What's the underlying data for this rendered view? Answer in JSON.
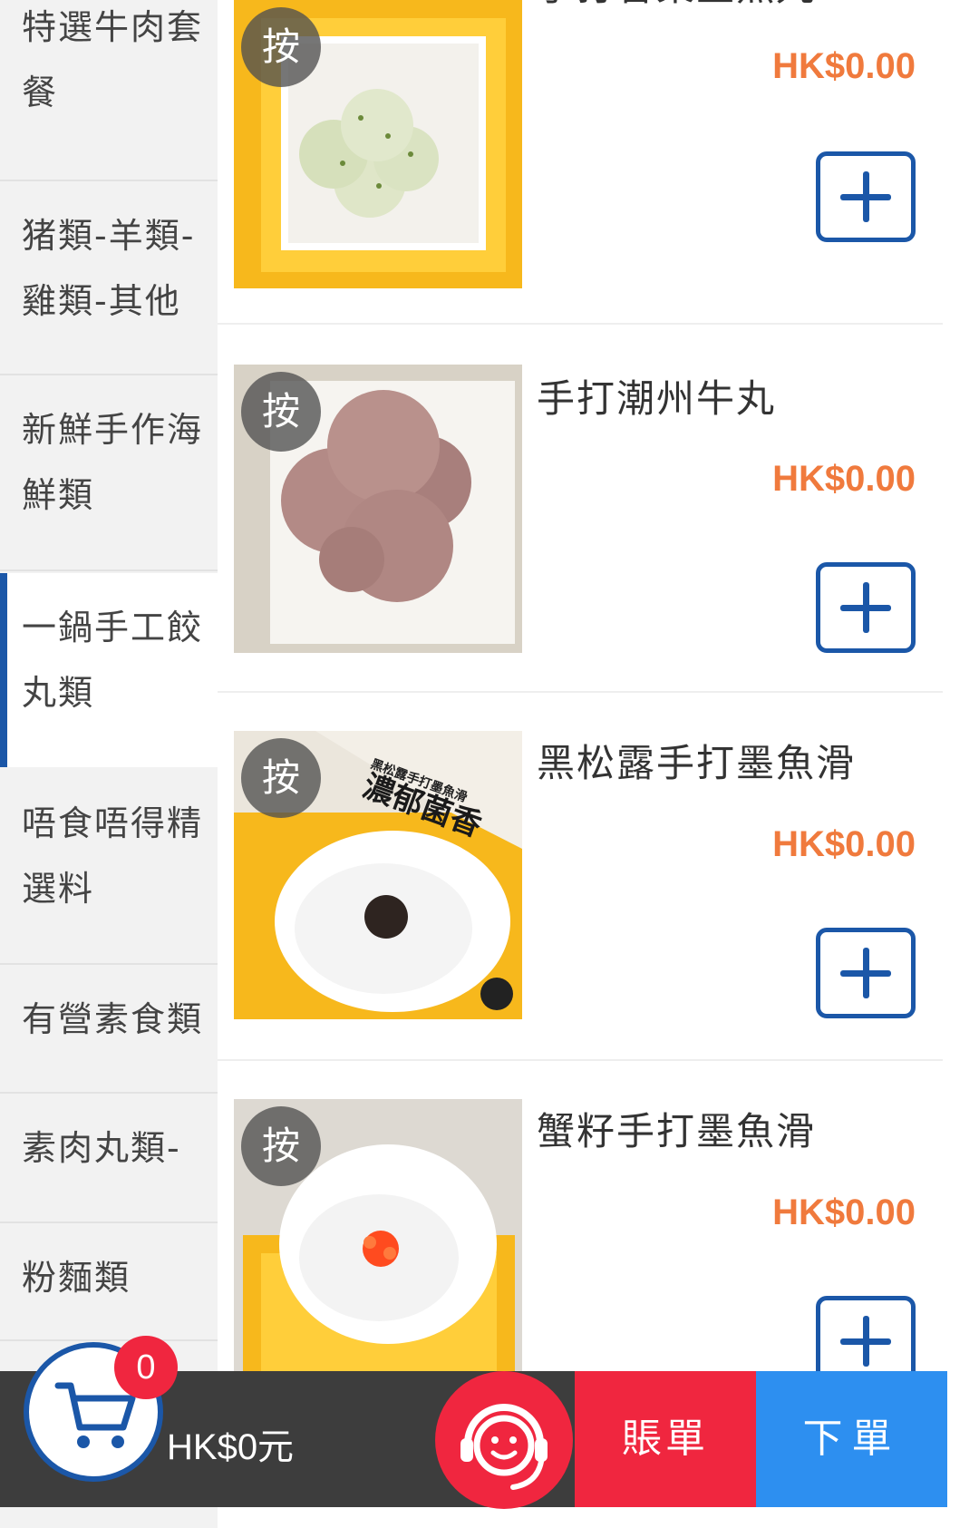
{
  "sidebar": {
    "categories": [
      {
        "label": "特選牛肉套餐"
      },
      {
        "label": "猪類-羊類-雞類-其他"
      },
      {
        "label": "新鮮手作海鮮類"
      },
      {
        "label": "一鍋手工餃丸類",
        "active": true
      },
      {
        "label": "唔食唔得精選料"
      },
      {
        "label": "有營素食類"
      },
      {
        "label": "素肉丸類-"
      },
      {
        "label": "粉麵類"
      }
    ]
  },
  "products": [
    {
      "name": "手打香菜墨魚丸",
      "price": "HK$0.00",
      "badge": "按",
      "image": "herb-cuttlefish-balls"
    },
    {
      "name": "手打潮州牛丸",
      "price": "HK$0.00",
      "badge": "按",
      "image": "beef-balls"
    },
    {
      "name": "黑松露手打墨魚滑",
      "price": "HK$0.00",
      "badge": "按",
      "image": "truffle-cuttlefish-paste",
      "image_text": {
        "line1": "濃郁菌香",
        "line2": "黑松露手打墨魚滑"
      }
    },
    {
      "name": "蟹籽手打墨魚滑",
      "price": "HK$0.00",
      "badge": "按",
      "image": "roe-cuttlefish-paste"
    }
  ],
  "cart": {
    "count": "0",
    "total": "HK$0元"
  },
  "actions": {
    "bill_label": "賬單",
    "order_label": "下單"
  },
  "colors": {
    "accent_blue": "#1b57a8",
    "price_orange": "#f07a3d",
    "bill_red": "#f0263f",
    "order_blue": "#2d8ff0"
  }
}
